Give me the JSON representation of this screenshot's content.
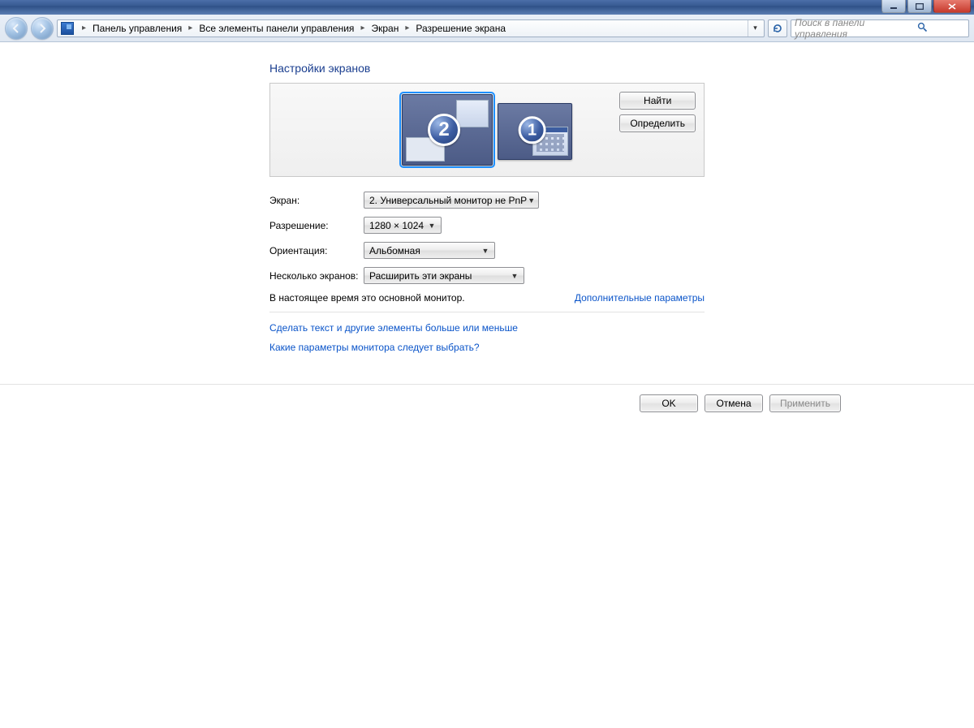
{
  "breadcrumb": {
    "items": [
      "Панель управления",
      "Все элементы панели управления",
      "Экран",
      "Разрешение экрана"
    ]
  },
  "search": {
    "placeholder": "Поиск в панели управления"
  },
  "heading": "Настройки экранов",
  "monitors": {
    "primary_number": "1",
    "secondary_number": "2"
  },
  "side_buttons": {
    "find": "Найти",
    "identify": "Определить"
  },
  "labels": {
    "screen": "Экран:",
    "resolution": "Разрешение:",
    "orientation": "Ориентация:",
    "multi": "Несколько экранов:"
  },
  "values": {
    "screen": "2. Универсальный монитор не PnP",
    "resolution": "1280 × 1024",
    "orientation": "Альбомная",
    "multi": "Расширить эти экраны"
  },
  "note": "В настоящее время это основной монитор.",
  "advanced_link": "Дополнительные параметры",
  "links": {
    "text_size": "Сделать текст и другие элементы больше или меньше",
    "which_settings": "Какие параметры монитора следует выбрать?"
  },
  "footer": {
    "ok": "OK",
    "cancel": "Отмена",
    "apply": "Применить"
  }
}
